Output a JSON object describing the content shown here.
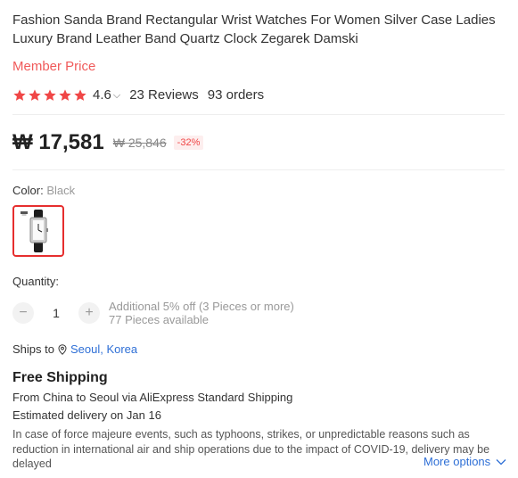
{
  "product": {
    "title": "Fashion Sanda Brand Rectangular Wrist Watches For Women Silver Case Ladies Luxury Brand Leather Band Quartz Clock Zegarek Damski",
    "member_price_label": "Member Price"
  },
  "rating": {
    "stars": 5,
    "score": "4.6",
    "reviews": "23 Reviews",
    "orders": "93 orders",
    "star_color": "#f04646"
  },
  "price": {
    "current": "₩ 17,581",
    "original": "₩ 25,846",
    "discount": "-32%"
  },
  "color": {
    "label": "Color:",
    "value": "Black",
    "selected_border_color": "#e62e2e"
  },
  "quantity": {
    "label": "Quantity:",
    "value": "1",
    "decrement_icon": "minus-icon",
    "increment_icon": "plus-icon",
    "offer": "Additional 5% off (3 Pieces or more)",
    "available": "77 Pieces available"
  },
  "shipping": {
    "ships_to_label": "Ships to",
    "location_icon": "location-pin-icon",
    "destination": "Seoul, Korea",
    "free_label": "Free Shipping",
    "from_text": "From China to Seoul via AliExpress Standard Shipping",
    "estimated": "Estimated delivery on Jan 16",
    "notice": "In case of force majeure events, such as typhoons, strikes, or unpredictable reasons such as reduction in international air and ship operations due to the impact of COVID-19, delivery may be delayed",
    "more_options": "More options",
    "link_color": "#2e6fd6"
  }
}
